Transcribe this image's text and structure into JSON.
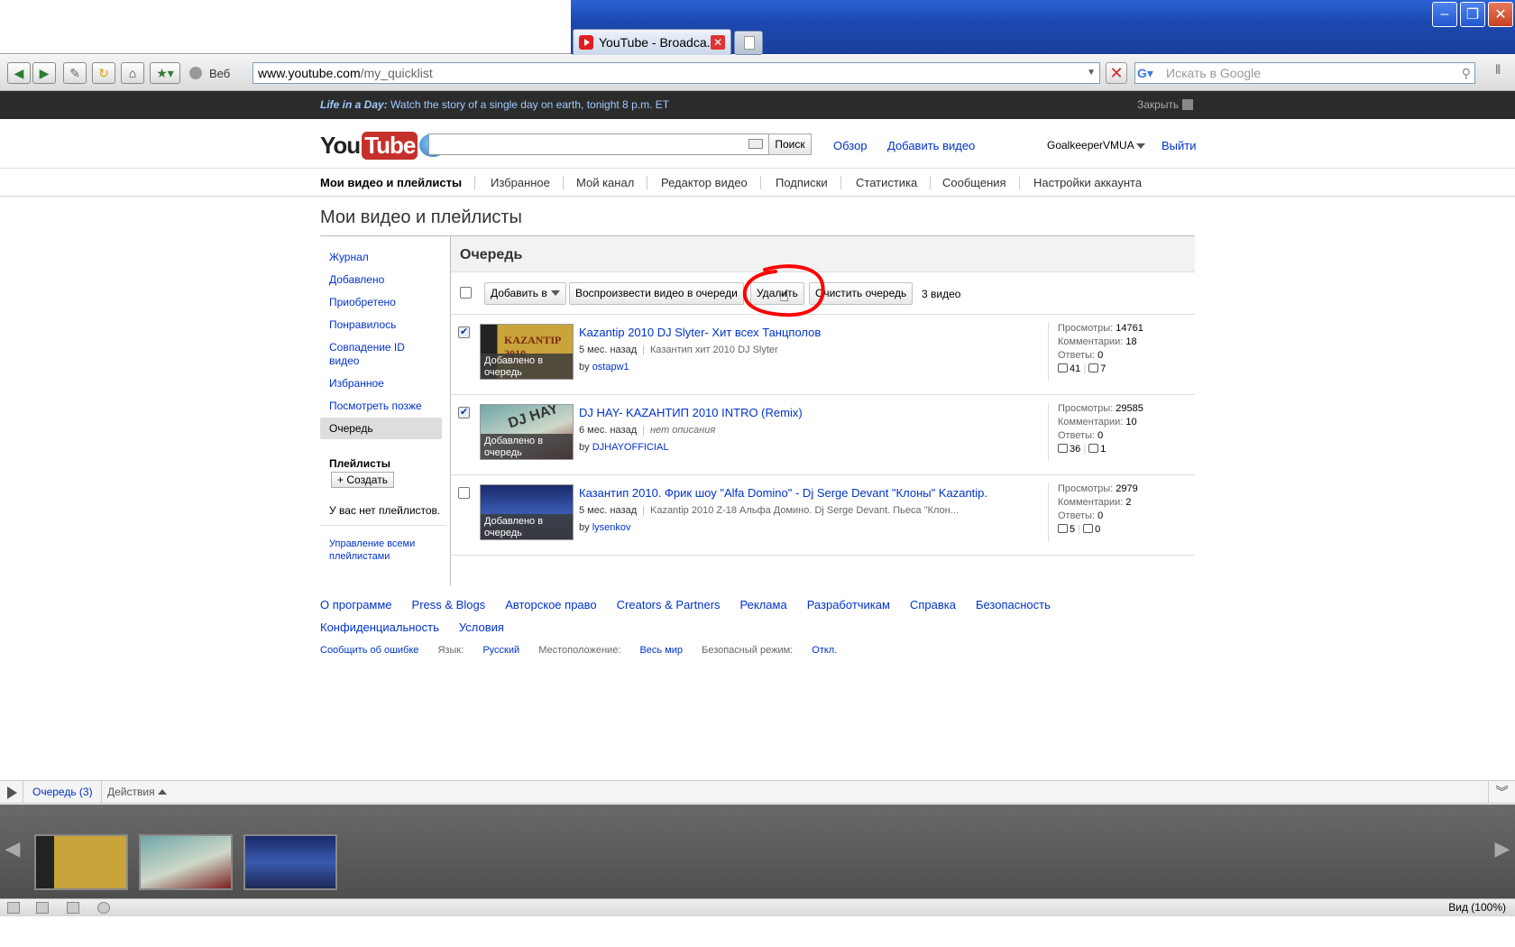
{
  "browser": {
    "tab_title": "YouTube - Broadca...",
    "web_label": "Веб",
    "address_host": "www.youtube.com",
    "address_path": "/my_quicklist",
    "search_placeholder": "Искать в Google",
    "zoom": "Вид (100%)"
  },
  "promo": {
    "title": "Life in a Day:",
    "text": " Watch the story of a single day on earth, tonight 8 p.m. ET",
    "close": "Закрыть"
  },
  "header": {
    "logo_you": "You",
    "logo_tube": "Tube",
    "search_button": "Поиск",
    "browse": "Обзор",
    "upload": "Добавить видео",
    "username": "GoalkeeperVMUA",
    "signout": "Выйти"
  },
  "tabs": [
    "Мои видео и плейлисты",
    "Избранное",
    "Мой канал",
    "Редактор видео",
    "Подписки",
    "Статистика",
    "Сообщения",
    "Настройки аккаунта"
  ],
  "page_title": "Мои видео и плейлисты",
  "sidebar": {
    "items": [
      "Журнал",
      "Добавлено",
      "Приобретено",
      "Понравилось",
      "Совпадение ID видео",
      "Избранное",
      "Посмотреть позже",
      "Очередь"
    ],
    "playlists_heading": "Плейлисты",
    "create_button": "+ Создать",
    "no_playlists": "У вас нет плейлистов.",
    "manage_all": "Управление всеми плейлистами"
  },
  "queue": {
    "heading": "Очередь",
    "add_to": "Добавить в",
    "play_queue": "Воспроизвести видео в очереди",
    "delete": "Удалить",
    "clear_queue": "Очистить очередь",
    "count": "3 видео",
    "added_label": "Добавлено в очередь",
    "videos": [
      {
        "title": "Kazantip 2010 DJ Slyter- Хит всех Танцполов",
        "age": "5 мес. назад",
        "description": "Казантип хит 2010 DJ Slyter",
        "by": "by",
        "author": "ostapw1",
        "views_label": "Просмотры:",
        "views": "14761",
        "comments_label": "Комментарии:",
        "comments": "18",
        "replies_label": "Ответы:",
        "replies": "0",
        "likes": "41",
        "dislikes": "7",
        "checked": true,
        "thumb_text": "KAZANTIP 2010"
      },
      {
        "title": "DJ HAY- KAZAНТИП 2010 INTRO (Remix)",
        "age": "6 мес. назад",
        "description": "нет описания",
        "by": "by",
        "author": "DJHAYOFFICIAL",
        "views_label": "Просмотры:",
        "views": "29585",
        "comments_label": "Комментарии:",
        "comments": "10",
        "replies_label": "Ответы:",
        "replies": "0",
        "likes": "36",
        "dislikes": "1",
        "checked": true,
        "thumb_text": "DJ HAY"
      },
      {
        "title": "Казантип 2010. Фрик шоу \"Alfa Domino\" - Dj Serge Devant \"Клоны\" Kazantip.",
        "age": "5 мес. назад",
        "description": "Kazantip 2010 Z-18 Альфа Домино. Dj Serge Devant. Пьеса \"Клон...",
        "by": "by",
        "author": "lysenkov",
        "views_label": "Просмотры:",
        "views": "2979",
        "comments_label": "Комментарии:",
        "comments": "2",
        "replies_label": "Ответы:",
        "replies": "0",
        "likes": "5",
        "dislikes": "0",
        "checked": false,
        "thumb_text": ""
      }
    ]
  },
  "footer": {
    "row1": [
      "О программе",
      "Press & Blogs",
      "Авторское право",
      "Creators & Partners",
      "Реклама",
      "Разработчикам",
      "Справка",
      "Безопасность"
    ],
    "row2": [
      "Конфиденциальность",
      "Условия"
    ],
    "report": "Сообщить об ошибке",
    "lang_label": "Язык:",
    "lang_value": "Русский",
    "loc_label": "Местоположение:",
    "loc_value": "Весь мир",
    "safe_label": "Безопасный режим:",
    "safe_value": "Откл."
  },
  "quicklist_bar": {
    "queue_link": "Очередь (3)",
    "actions": "Действия"
  },
  "colors": {
    "link": "#0033cc",
    "promo_bg": "#2b2b2b",
    "annotation": "#ff0000"
  }
}
